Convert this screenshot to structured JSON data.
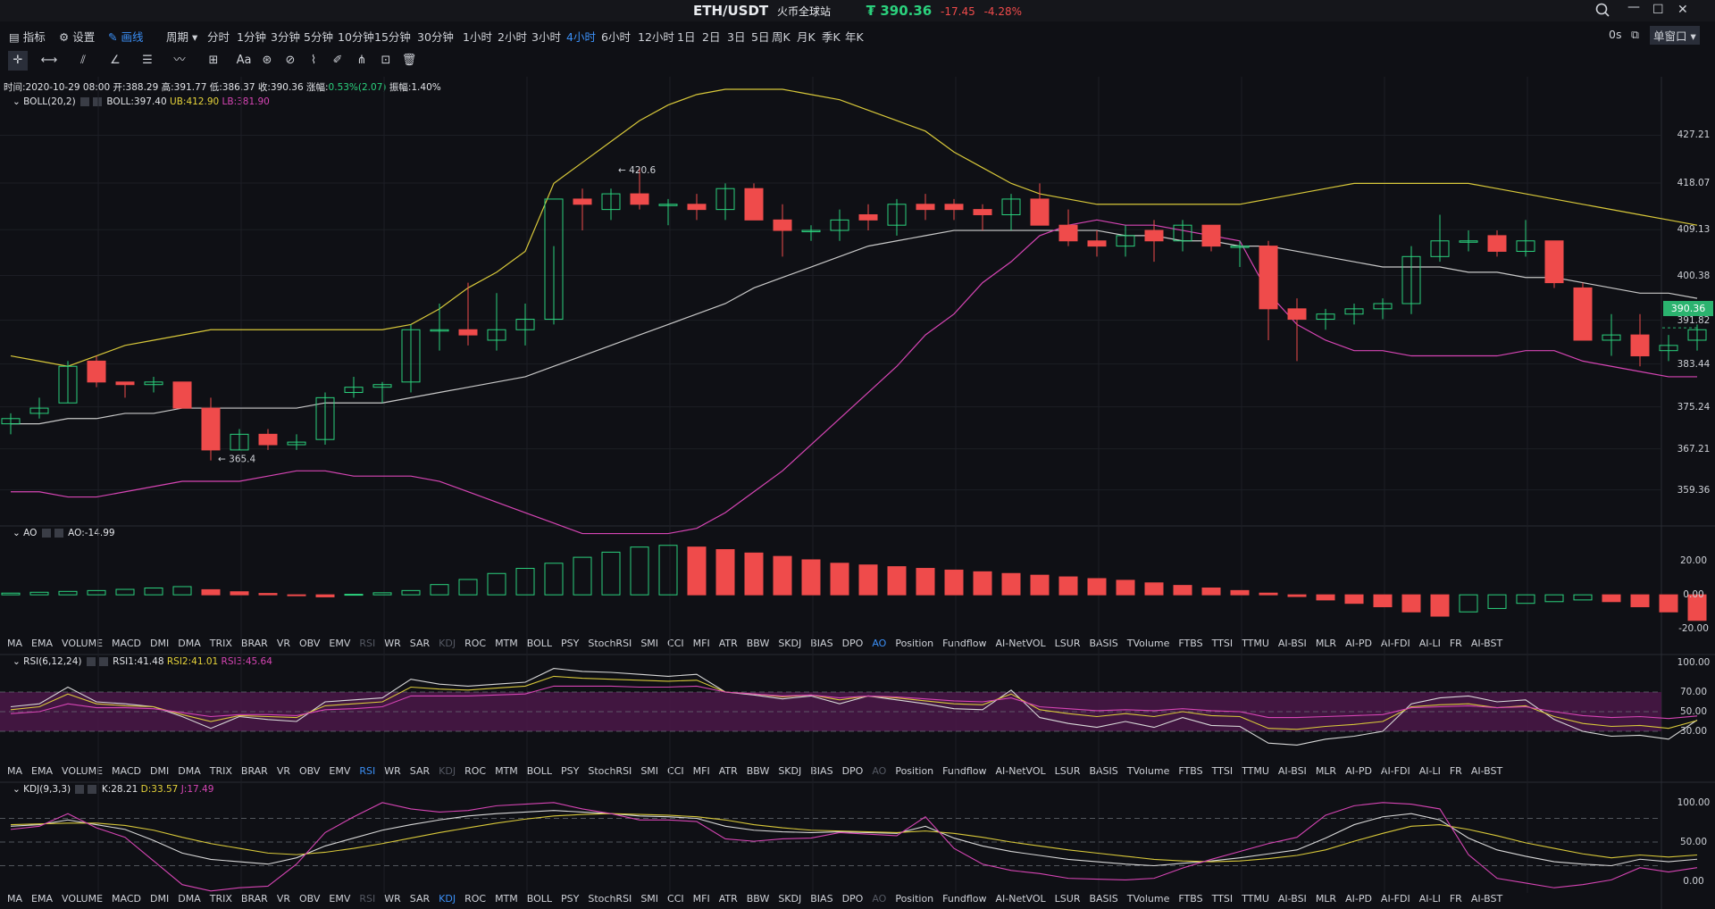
{
  "titlebar": {
    "pair": "ETH/USDT",
    "exchange": "火币全球站",
    "price": "₮ 390.36",
    "change": "-17.45",
    "change_pct": "-4.28%",
    "window_controls": [
      "search-icon",
      "minimize-icon",
      "maximize-icon",
      "close-icon"
    ]
  },
  "toolbar": {
    "indicators": "指标",
    "settings": "设置",
    "draw": "画线",
    "period": "周期",
    "intervals": [
      "分时",
      "1分钟",
      "3分钟",
      "5分钟",
      "10分钟",
      "15分钟",
      "30分钟",
      "1小时",
      "2小时",
      "3小时",
      "4小时",
      "6小时",
      "12小时",
      "1日",
      "2日",
      "3日",
      "5日",
      "周K",
      "月K",
      "季K",
      "年K"
    ],
    "active_interval": "4小时",
    "refresh": "0s",
    "window_mode": "单窗口"
  },
  "info": {
    "time": "时间:2020-10-29 08:00",
    "open": "开:388.29",
    "high": "高:391.77",
    "low": "低:386.37",
    "close": "收:390.36",
    "change_label": "涨幅:",
    "change_val": "0.53%(2.07)",
    "amplitude": "振幅:1.40%"
  },
  "boll": {
    "name": "BOLL(20,2)",
    "mid": "BOLL:397.40",
    "ub": "UB:412.90",
    "lb": "LB:381.90"
  },
  "ao": {
    "name": "AO",
    "val": "AO:-14.99"
  },
  "rsi": {
    "name": "RSI(6,12,24)",
    "r1": "RSI1:41.48",
    "r2": "RSI2:41.01",
    "r3": "RSI3:45.64"
  },
  "kdj": {
    "name": "KDJ(9,3,3)",
    "k": "K:28.21",
    "d": "D:33.57",
    "j": "J:17.49"
  },
  "indicator_tabs": [
    "MA",
    "EMA",
    "VOLUME",
    "MACD",
    "DMI",
    "DMA",
    "TRIX",
    "BRAR",
    "VR",
    "OBV",
    "EMV",
    "RSI",
    "WR",
    "SAR",
    "KDJ",
    "ROC",
    "MTM",
    "BOLL",
    "PSY",
    "StochRSI",
    "SMI",
    "CCI",
    "MFI",
    "ATR",
    "BBW",
    "SKDJ",
    "BIAS",
    "DPO",
    "AO",
    "Position",
    "Fundflow",
    "AI-NetVOL",
    "LSUR",
    "BASIS",
    "TVolume",
    "FTBS",
    "TTSI",
    "TTMU",
    "AI-BSI",
    "MLR",
    "AI-PD",
    "AI-FDI",
    "AI-LI",
    "FR",
    "AI-BST"
  ],
  "colors": {
    "up": "#2bd17d",
    "down": "#ef4b4b",
    "boll_ub": "#d8c83a",
    "boll_mid": "#c9c9c9",
    "boll_lb": "#d645b4",
    "rsi_band": "#4a1848"
  },
  "chart_data": [
    {
      "type": "candlestick",
      "title": "BOLL(20,2)",
      "y_ticks": [
        "427.21",
        "418.07",
        "409.13",
        "400.38",
        "391.82",
        "383.44",
        "375.24",
        "367.21",
        "359.36"
      ],
      "ylim": [
        354,
        436
      ],
      "current_price": "390.36",
      "annotations": {
        "high_label": "← 420.6",
        "low_label": "← 365.4"
      },
      "ohlc": [
        [
          372,
          374,
          370,
          373
        ],
        [
          374,
          377,
          373,
          375
        ],
        [
          376,
          384,
          376,
          383
        ],
        [
          384,
          385,
          379,
          380
        ],
        [
          380,
          380,
          377,
          379.5
        ],
        [
          379.5,
          381,
          378,
          380
        ],
        [
          380,
          380,
          375,
          375
        ],
        [
          375,
          377,
          365,
          367
        ],
        [
          367,
          371,
          367,
          370
        ],
        [
          370,
          371,
          367,
          368
        ],
        [
          368,
          370,
          367,
          368.5
        ],
        [
          369,
          378,
          368,
          377
        ],
        [
          378,
          381,
          377,
          379
        ],
        [
          379,
          380,
          376,
          379.5
        ],
        [
          380,
          391,
          378,
          390
        ],
        [
          390,
          395,
          386,
          390
        ],
        [
          390,
          399,
          387,
          389
        ],
        [
          388,
          397,
          386,
          390
        ],
        [
          390,
          395,
          387,
          392
        ],
        [
          392,
          406,
          391,
          415
        ],
        [
          415,
          417,
          409,
          414
        ],
        [
          413,
          417,
          411,
          416
        ],
        [
          416,
          421,
          413,
          414
        ],
        [
          414,
          415,
          410,
          414
        ],
        [
          414,
          416,
          411,
          413
        ],
        [
          413,
          418,
          411,
          417
        ],
        [
          417,
          418,
          412,
          411
        ],
        [
          411,
          414,
          404,
          409
        ],
        [
          409,
          410,
          407,
          409
        ],
        [
          409,
          413,
          407,
          411
        ],
        [
          412,
          414,
          409,
          411
        ],
        [
          410,
          415,
          408,
          414
        ],
        [
          414,
          416,
          411,
          413
        ],
        [
          414,
          415,
          411,
          413
        ],
        [
          413,
          414,
          409,
          412
        ],
        [
          412,
          416,
          409,
          415
        ],
        [
          415,
          418,
          410,
          410
        ],
        [
          410,
          413,
          406,
          407
        ],
        [
          407,
          409,
          404,
          406
        ],
        [
          406,
          410,
          404,
          408
        ],
        [
          409,
          411,
          403,
          407
        ],
        [
          407,
          411,
          405,
          410
        ],
        [
          410,
          410,
          405,
          406
        ],
        [
          406,
          407,
          402,
          406
        ],
        [
          406,
          407,
          388,
          394
        ],
        [
          394,
          396,
          384,
          392
        ],
        [
          392,
          394,
          390,
          393
        ],
        [
          393,
          395,
          391,
          394
        ],
        [
          394,
          396,
          392,
          395
        ],
        [
          395,
          406,
          393,
          404
        ],
        [
          404,
          412,
          403,
          407
        ],
        [
          407,
          409,
          405,
          407
        ],
        [
          408,
          409,
          404,
          405
        ],
        [
          405,
          411,
          404,
          407
        ],
        [
          407,
          407,
          398,
          399
        ],
        [
          398,
          399,
          388,
          388
        ],
        [
          388,
          393,
          385,
          389
        ],
        [
          389,
          393,
          383,
          385
        ],
        [
          386,
          389,
          384,
          387
        ],
        [
          388,
          391,
          386,
          390
        ]
      ],
      "series": [
        {
          "name": "UB",
          "values": [
            385,
            384,
            383,
            385,
            387,
            388,
            389,
            390,
            390,
            390,
            390,
            390,
            390,
            390,
            391,
            394,
            398,
            401,
            405,
            418,
            422,
            426,
            430,
            433,
            435,
            436,
            436,
            436,
            435,
            434,
            432,
            430,
            428,
            424,
            421,
            418,
            416,
            415,
            414,
            414,
            414,
            414,
            414,
            414,
            415,
            416,
            417,
            418,
            418,
            418,
            418,
            418,
            417,
            416,
            415,
            414,
            413,
            412,
            411,
            410
          ]
        },
        {
          "name": "MID",
          "values": [
            372,
            372,
            373,
            373,
            374,
            374,
            375,
            375,
            375,
            375,
            375,
            376,
            376,
            376,
            377,
            378,
            379,
            380,
            381,
            383,
            385,
            387,
            389,
            391,
            393,
            395,
            398,
            400,
            402,
            404,
            406,
            407,
            408,
            409,
            409,
            409,
            409,
            409,
            409,
            408,
            408,
            407,
            407,
            406,
            406,
            405,
            404,
            403,
            402,
            402,
            402,
            401,
            401,
            400,
            400,
            399,
            398,
            397,
            397,
            396
          ]
        },
        {
          "name": "LB",
          "values": [
            359,
            359,
            358,
            358,
            359,
            360,
            361,
            361,
            361,
            362,
            363,
            363,
            362,
            362,
            362,
            361,
            359,
            357,
            355,
            353,
            351,
            351,
            351,
            351,
            352,
            355,
            359,
            363,
            368,
            373,
            378,
            383,
            389,
            393,
            399,
            403,
            408,
            410,
            411,
            410,
            410,
            409,
            408,
            407,
            397,
            391,
            388,
            386,
            386,
            385,
            385,
            385,
            385,
            386,
            386,
            384,
            383,
            382,
            381,
            381
          ]
        }
      ]
    },
    {
      "type": "bar",
      "title": "AO",
      "y_ticks": [
        "20.00",
        "0.00",
        "-20.00"
      ],
      "ylim": [
        -24,
        32
      ],
      "values": [
        1,
        1.5,
        2,
        2.5,
        3.2,
        4,
        4.8,
        3,
        1.8,
        0.8,
        -0.5,
        -1.2,
        0.3,
        1.2,
        2.5,
        6,
        9,
        12.5,
        15.5,
        18.5,
        22,
        25,
        28,
        29,
        28,
        26.5,
        24.5,
        22.5,
        20.5,
        18.5,
        17.5,
        16.5,
        15.5,
        14.5,
        13.5,
        12.5,
        11.5,
        10.5,
        9.5,
        8.5,
        7,
        5.5,
        4,
        2.5,
        1,
        -1,
        -3,
        -5,
        -7,
        -10,
        -12.5,
        -10,
        -8,
        -5,
        -4,
        -3,
        -4,
        -7,
        -10,
        -14.99
      ],
      "negative_hollow_from": 50
    },
    {
      "type": "line",
      "title": "RSI(6,12,24)",
      "y_ticks": [
        "100.00",
        "70.00",
        "50.00",
        "30.00"
      ],
      "ylim": [
        0,
        100
      ],
      "series": [
        {
          "name": "RSI1",
          "values": [
            55,
            58,
            75,
            60,
            58,
            55,
            45,
            33,
            45,
            42,
            40,
            60,
            62,
            64,
            83,
            78,
            76,
            78,
            80,
            94,
            91,
            90,
            88,
            86,
            88,
            70,
            67,
            63,
            66,
            58,
            66,
            62,
            58,
            53,
            52,
            72,
            44,
            38,
            34,
            40,
            34,
            44,
            36,
            35,
            18,
            16,
            22,
            25,
            30,
            58,
            64,
            66,
            60,
            62,
            42,
            30,
            25,
            26,
            22,
            41.48
          ]
        },
        {
          "name": "RSI2",
          "values": [
            52,
            55,
            68,
            58,
            56,
            55,
            47,
            40,
            46,
            45,
            44,
            56,
            58,
            60,
            75,
            73,
            72,
            74,
            76,
            86,
            84,
            83,
            82,
            81,
            82,
            70,
            68,
            65,
            67,
            62,
            66,
            64,
            61,
            58,
            57,
            68,
            52,
            48,
            45,
            48,
            45,
            50,
            46,
            45,
            33,
            32,
            35,
            37,
            40,
            55,
            57,
            58,
            54,
            56,
            45,
            38,
            35,
            36,
            33,
            41.01
          ]
        },
        {
          "name": "RSI3",
          "values": [
            48,
            50,
            58,
            54,
            54,
            53,
            49,
            45,
            47,
            47,
            46,
            52,
            53,
            55,
            66,
            66,
            66,
            67,
            68,
            76,
            76,
            76,
            75,
            75,
            76,
            70,
            68,
            66,
            67,
            64,
            66,
            65,
            63,
            61,
            60,
            64,
            55,
            53,
            51,
            52,
            51,
            53,
            51,
            50,
            44,
            44,
            45,
            46,
            47,
            54,
            55,
            56,
            54,
            55,
            50,
            46,
            44,
            45,
            43,
            45.64
          ]
        }
      ]
    },
    {
      "type": "line",
      "title": "KDJ(9,3,3)",
      "y_ticks": [
        "100.00",
        "50.00",
        "0.00"
      ],
      "ylim": [
        -10,
        110
      ],
      "series": [
        {
          "name": "K",
          "values": [
            70,
            72,
            78,
            72,
            66,
            52,
            36,
            28,
            25,
            22,
            30,
            45,
            55,
            65,
            72,
            78,
            83,
            86,
            88,
            90,
            88,
            86,
            83,
            82,
            80,
            70,
            65,
            63,
            62,
            63,
            62,
            61,
            70,
            55,
            45,
            38,
            33,
            28,
            25,
            22,
            20,
            23,
            26,
            30,
            35,
            40,
            55,
            72,
            82,
            86,
            78,
            55,
            40,
            32,
            25,
            22,
            20,
            28.21,
            25,
            28.21
          ]
        },
        {
          "name": "D",
          "values": [
            72,
            73,
            74,
            74,
            71,
            65,
            56,
            48,
            42,
            36,
            34,
            37,
            42,
            48,
            55,
            62,
            68,
            74,
            79,
            83,
            85,
            86,
            85,
            84,
            82,
            78,
            72,
            68,
            65,
            64,
            63,
            62,
            64,
            61,
            56,
            50,
            45,
            40,
            36,
            32,
            28,
            26,
            25,
            26,
            29,
            33,
            40,
            51,
            61,
            70,
            72,
            66,
            58,
            49,
            42,
            35,
            30,
            33.57,
            31,
            33.57
          ]
        },
        {
          "name": "J",
          "values": [
            66,
            70,
            86,
            68,
            56,
            26,
            -4,
            -12,
            -8,
            -6,
            22,
            62,
            82,
            100,
            92,
            88,
            90,
            96,
            98,
            100,
            92,
            86,
            78,
            78,
            76,
            54,
            51,
            54,
            55,
            62,
            60,
            58,
            82,
            42,
            22,
            14,
            10,
            4,
            3,
            2,
            4,
            17,
            28,
            38,
            48,
            56,
            84,
            96,
            100,
            98,
            92,
            34,
            4,
            -2,
            -8,
            -4,
            2,
            17.49,
            12,
            17.49
          ]
        }
      ]
    }
  ]
}
